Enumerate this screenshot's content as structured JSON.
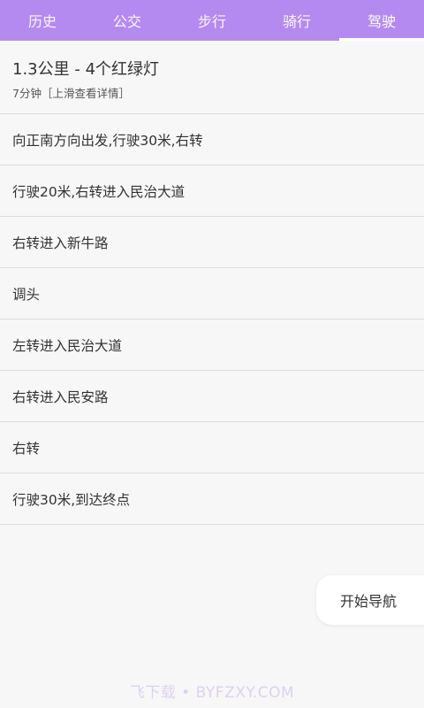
{
  "tabs": [
    {
      "label": "历史",
      "active": false
    },
    {
      "label": "公交",
      "active": false
    },
    {
      "label": "步行",
      "active": false
    },
    {
      "label": "骑行",
      "active": false
    },
    {
      "label": "驾驶",
      "active": true
    }
  ],
  "summary": {
    "title": "1.3公里 - 4个红绿灯",
    "subtitle": "7分钟［上滑查看详情］"
  },
  "steps": [
    "向正南方向出发,行驶30米,右转",
    "行驶20米,右转进入民治大道",
    "右转进入新牛路",
    "调头",
    "左转进入民治大道",
    "右转进入民安路",
    "右转",
    "行驶30米,到达终点"
  ],
  "start_nav_label": "开始导航",
  "watermark": "飞下载 • BYFZXY.COM",
  "colors": {
    "tab_bar": "#b58af0",
    "background": "#f7f7f8",
    "divider": "#dcdcdc"
  }
}
